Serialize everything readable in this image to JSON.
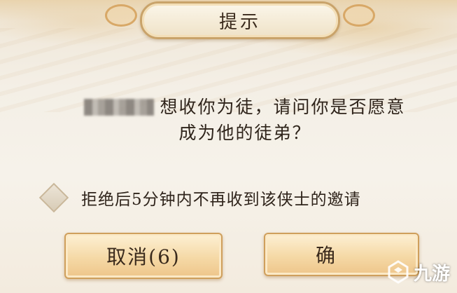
{
  "dialog": {
    "title": "提示",
    "message_line1": "想收你为徒，请问你是否愿意",
    "message_line2": "成为他的徒弟？",
    "option_label": "拒绝后5分钟内不再收到该侠士的邀请",
    "option_checked": false
  },
  "buttons": {
    "cancel_label": "取消(6)",
    "confirm_label": "确"
  },
  "watermark": {
    "text": "九游",
    "logo": "9-logo-icon"
  },
  "colors": {
    "accent": "#c9a36a",
    "text": "#2f241b",
    "button_fill": "#f5d9a6"
  }
}
